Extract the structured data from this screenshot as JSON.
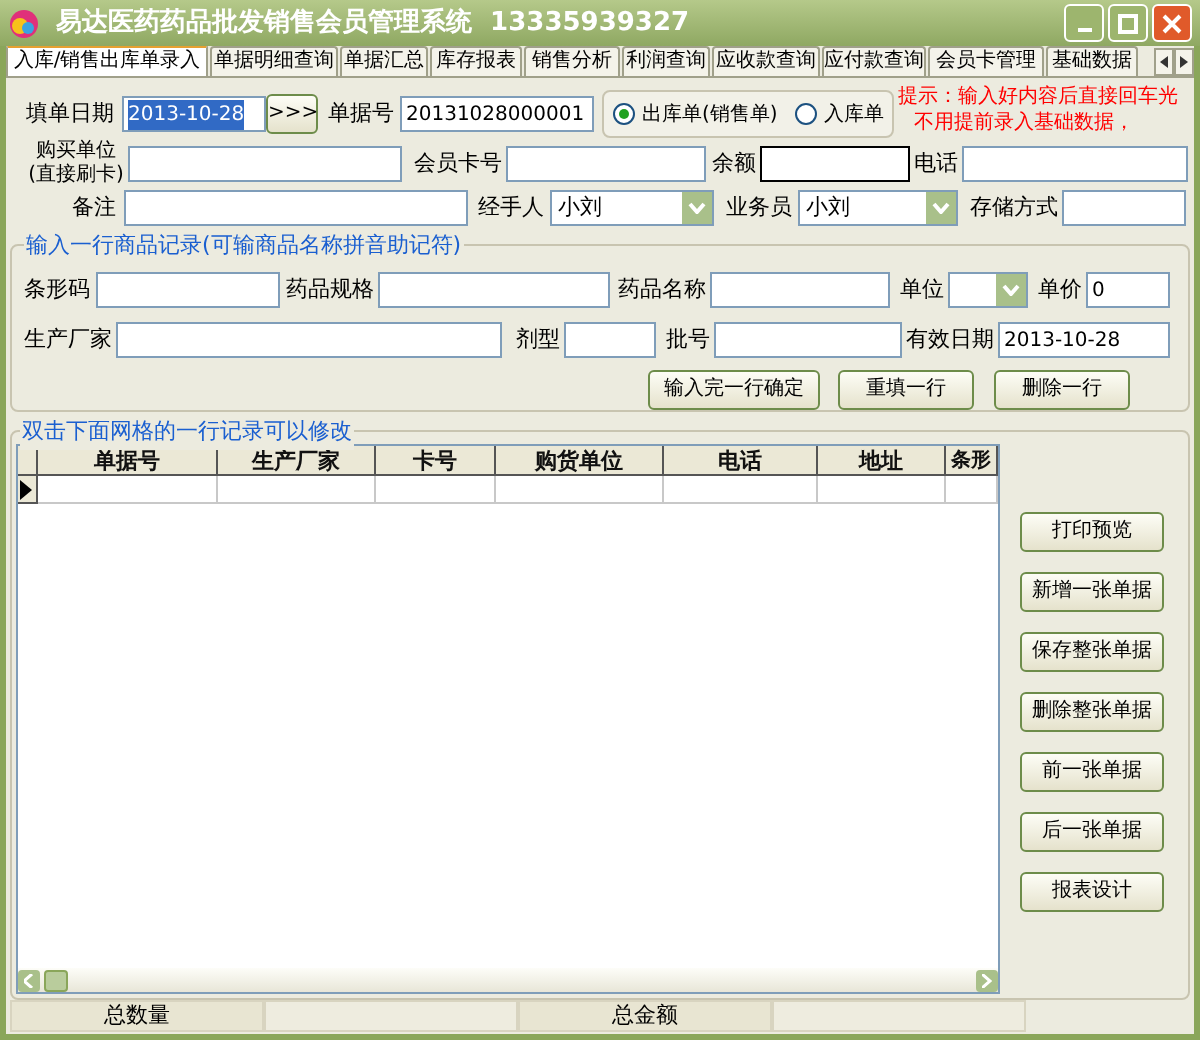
{
  "window": {
    "title": "易达医药药品批发销售会员管理系统  13335939327"
  },
  "tabs": [
    {
      "label": "入库/销售出库单录入",
      "selected": true
    },
    {
      "label": "单据明细查询",
      "selected": false
    },
    {
      "label": "单据汇总",
      "selected": false
    },
    {
      "label": "库存报表",
      "selected": false
    },
    {
      "label": "销售分析",
      "selected": false
    },
    {
      "label": "利润查询",
      "selected": false
    },
    {
      "label": "应收款查询",
      "selected": false
    },
    {
      "label": "应付款查询",
      "selected": false
    },
    {
      "label": "会员卡管理",
      "selected": false
    },
    {
      "label": "基础数据",
      "selected": false
    }
  ],
  "order_form": {
    "lines": [
      {
        "items": [
          {
            "kind": "label",
            "text": "填单日期"
          },
          {
            "kind": "field",
            "value": "2013-10-28",
            "highlighted": true
          },
          {
            "kind": "button",
            "text": ">>>"
          },
          {
            "kind": "label",
            "text": "单据号"
          },
          {
            "kind": "field",
            "value": "20131028000001"
          },
          {
            "kind": "radio_group",
            "options": [
              {
                "label": "出库单(销售单)",
                "selected": true
              },
              {
                "label": "入库单",
                "selected": false
              }
            ]
          },
          {
            "kind": "hint",
            "lines": [
              "提示：输入好内容后直接回车光",
              "不用提前录入基础数据，"
            ]
          }
        ]
      },
      {
        "items": [
          {
            "kind": "label",
            "text": "购买单位\n(直接刷卡)"
          },
          {
            "kind": "field"
          },
          {
            "kind": "label",
            "text": "会员卡号"
          },
          {
            "kind": "field"
          },
          {
            "kind": "label",
            "text": "余额"
          },
          {
            "kind": "field",
            "focused": true
          },
          {
            "kind": "label",
            "text": "电话"
          },
          {
            "kind": "field"
          }
        ]
      },
      {
        "items": [
          {
            "kind": "label",
            "text": "备注"
          },
          {
            "kind": "field"
          },
          {
            "kind": "label",
            "text": "经手人"
          },
          {
            "kind": "dropdown",
            "value": "小刘"
          },
          {
            "kind": "label",
            "text": "业务员"
          },
          {
            "kind": "dropdown",
            "value": "小刘"
          },
          {
            "kind": "label",
            "text": "存储方式"
          },
          {
            "kind": "field"
          }
        ]
      }
    ]
  },
  "product_form": {
    "title": "输入一行商品记录(可输商品名称拼音助记符)",
    "lines": [
      {
        "items": [
          {
            "kind": "label",
            "text": "条形码"
          },
          {
            "kind": "field"
          },
          {
            "kind": "label",
            "text": "药品规格"
          },
          {
            "kind": "field"
          },
          {
            "kind": "label",
            "text": "药品名称"
          },
          {
            "kind": "field"
          },
          {
            "kind": "label",
            "text": "单位"
          },
          {
            "kind": "dropdown"
          },
          {
            "kind": "label",
            "text": "单价"
          },
          {
            "kind": "field",
            "value": "0"
          }
        ]
      },
      {
        "items": [
          {
            "kind": "label",
            "text": "生产厂家"
          },
          {
            "kind": "field"
          },
          {
            "kind": "label",
            "text": "剂型"
          },
          {
            "kind": "field"
          },
          {
            "kind": "label",
            "text": "批号"
          },
          {
            "kind": "field"
          },
          {
            "kind": "label",
            "text": "有效日期"
          },
          {
            "kind": "field",
            "value": "2013-10-28"
          }
        ]
      },
      {
        "items": [
          {
            "kind": "button",
            "text": "输入完一行确定"
          },
          {
            "kind": "button",
            "text": "重填一行"
          },
          {
            "kind": "button",
            "text": "删除一行"
          }
        ]
      }
    ]
  },
  "grid_section": {
    "title": "双击下面网格的一行记录可以修改",
    "columns": [
      "单据号",
      "生产厂家",
      "卡号",
      "购货单位",
      "电话",
      "地址",
      "条形"
    ],
    "rows": [
      {
        "selected": true
      }
    ]
  },
  "actions": [
    "打印预览",
    "新增一张单据",
    "保存整张单据",
    "删除整张单据",
    "前一张单据",
    "后一张单据",
    "报表设计"
  ],
  "status_bar": {
    "cells": [
      "总数量",
      "总金额"
    ]
  }
}
